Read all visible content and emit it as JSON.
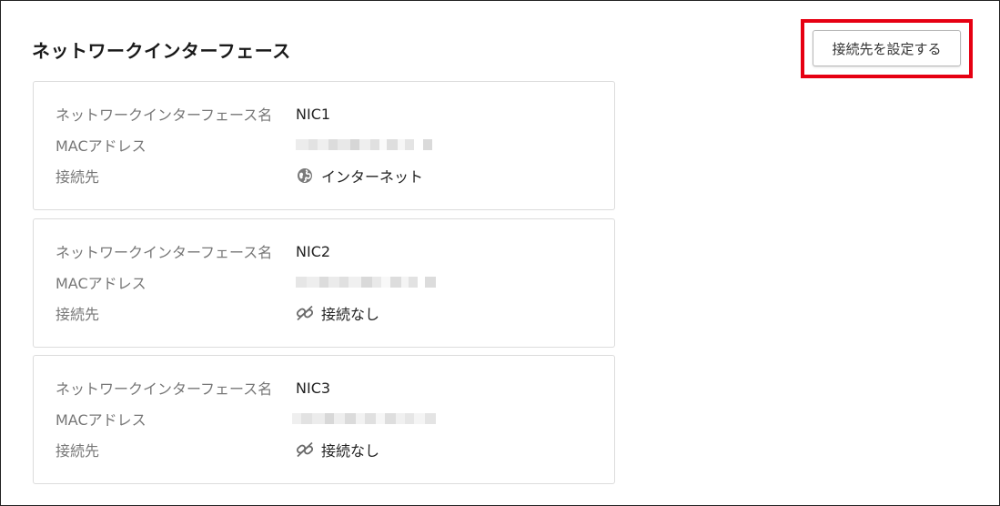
{
  "page": {
    "title": "ネットワークインターフェース",
    "set_connection_button": "接続先を設定する"
  },
  "labels": {
    "nic_name": "ネットワークインターフェース名",
    "mac": "MACアドレス",
    "destination": "接続先"
  },
  "nics": [
    {
      "name": "NIC1",
      "destination": "インターネット",
      "destination_icon": "globe-icon"
    },
    {
      "name": "NIC2",
      "destination": "接続なし",
      "destination_icon": "unlinked-icon"
    },
    {
      "name": "NIC3",
      "destination": "接続なし",
      "destination_icon": "unlinked-icon"
    }
  ],
  "colors": {
    "highlight": "#e60012",
    "mac_blur_light": "#ececec",
    "mac_blur_dark": "#d8d8d8"
  }
}
